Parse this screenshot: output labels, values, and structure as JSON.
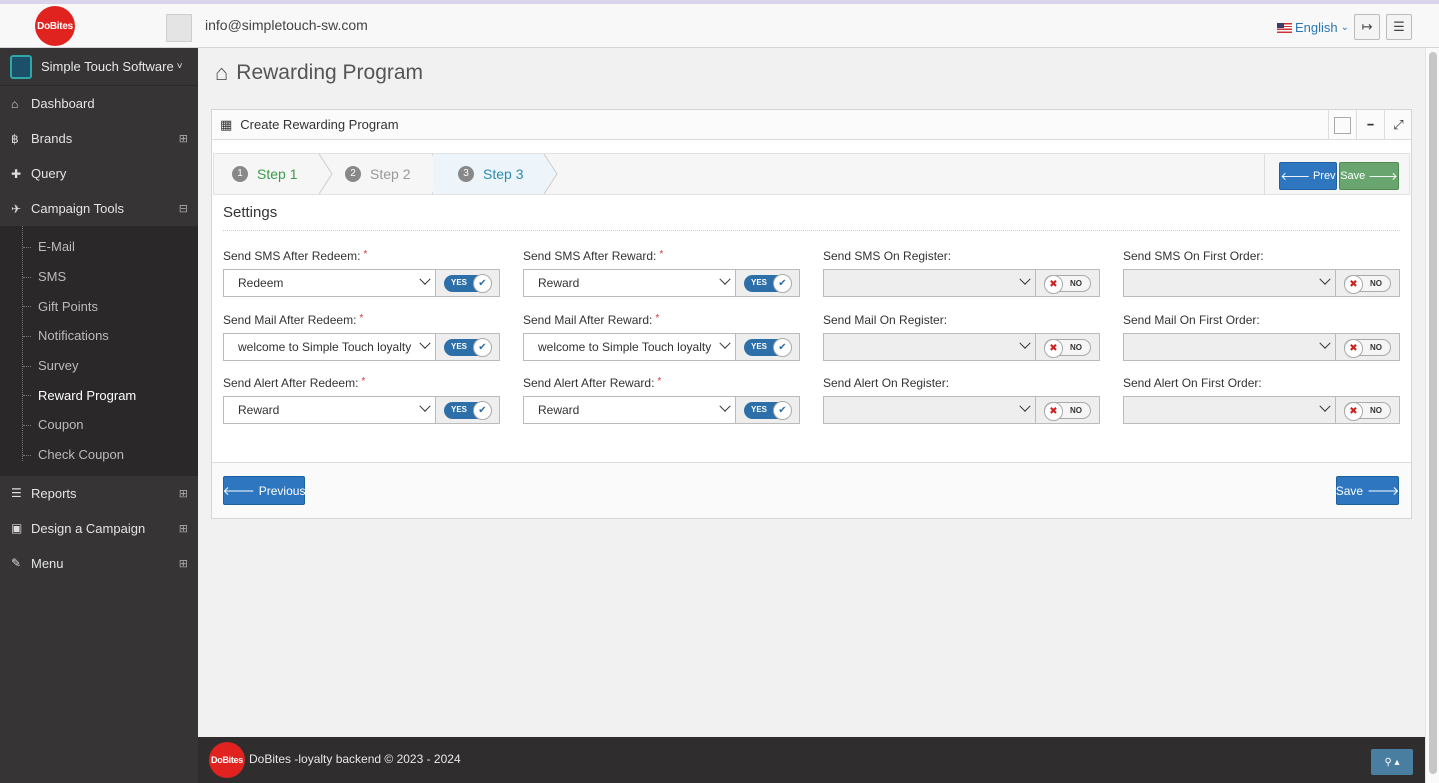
{
  "header": {
    "logo_text": "DoBites",
    "user_email": "info@simpletouch-sw.com",
    "language": "English",
    "language_caret": "⌄",
    "logout_icon": "↦",
    "menu_icon": "☰"
  },
  "sidebar": {
    "site_name": "Simple Touch Software",
    "site_caret": "˅",
    "items": [
      {
        "label": "Dashboard",
        "icon": "⌂",
        "plus": ""
      },
      {
        "label": "Brands",
        "icon": "฿",
        "plus": "⊞"
      },
      {
        "label": "Query",
        "icon": "✚",
        "plus": ""
      },
      {
        "label": "Campaign Tools",
        "icon": "✈",
        "plus": "⊟"
      }
    ],
    "sub_items": [
      "E-Mail",
      "SMS",
      "Gift Points",
      "Notifications",
      "Survey",
      "Reward Program",
      "Coupon",
      "Check Coupon"
    ],
    "bottom_items": [
      {
        "label": "Reports",
        "icon": "☰",
        "plus": "⊞"
      },
      {
        "label": "Design a Campaign",
        "icon": "▣",
        "plus": "⊞"
      },
      {
        "label": "Menu",
        "icon": "✎",
        "plus": "⊞"
      }
    ]
  },
  "page": {
    "title": "Rewarding Program",
    "home_icon": "⌂"
  },
  "panel": {
    "title": "Create Rewarding Program",
    "table_icon": "▦",
    "minimize_icon": "━",
    "expand_icon": "⤢",
    "steps": [
      {
        "num": "1",
        "label": "Step 1"
      },
      {
        "num": "2",
        "label": "Step 2"
      },
      {
        "num": "3",
        "label": "Step 3"
      }
    ],
    "prev_top": "Prev",
    "save_top": "Save",
    "settings_title": "Settings",
    "prev_button": "Previous",
    "save_button": "Save",
    "arrow_left": "🡐",
    "arrow_right": "🡒"
  },
  "fields": [
    {
      "label": "Send SMS After Redeem:",
      "required": "*",
      "value": "Redeem",
      "toggle": "YES"
    },
    {
      "label": "Send SMS After Reward:",
      "required": "*",
      "value": "Reward",
      "toggle": "YES"
    },
    {
      "label": "Send SMS On Register:",
      "required": "",
      "value": "",
      "toggle": "NO"
    },
    {
      "label": "Send SMS On First Order:",
      "required": "",
      "value": "",
      "toggle": "NO"
    },
    {
      "label": "Send Mail After Redeem:",
      "required": "*",
      "value": "welcome to Simple Touch loyalty",
      "toggle": "YES"
    },
    {
      "label": "Send Mail After Reward:",
      "required": "*",
      "value": "welcome to Simple Touch loyalty",
      "toggle": "YES"
    },
    {
      "label": "Send Mail On Register:",
      "required": "",
      "value": "",
      "toggle": "NO"
    },
    {
      "label": "Send Mail On First Order:",
      "required": "",
      "value": "",
      "toggle": "NO"
    },
    {
      "label": "Send Alert After Redeem:",
      "required": "*",
      "value": "Reward",
      "toggle": "YES"
    },
    {
      "label": "Send Alert After Reward:",
      "required": "*",
      "value": "Reward",
      "toggle": "YES"
    },
    {
      "label": "Send Alert On Register:",
      "required": "",
      "value": "",
      "toggle": "NO"
    },
    {
      "label": "Send Alert On First Order:",
      "required": "",
      "value": "",
      "toggle": "NO"
    }
  ],
  "footer": {
    "logo_text": "DoBites",
    "text": "DoBites -loyalty backend © 2023 - 2024",
    "scroll_button": "⚲ ▴"
  },
  "colors": {
    "accent": "#2e77c0",
    "success": "#69a56e",
    "brand_red": "#e1231f",
    "step_done": "#3a9b4a",
    "step_active": "#2a8bb0"
  }
}
